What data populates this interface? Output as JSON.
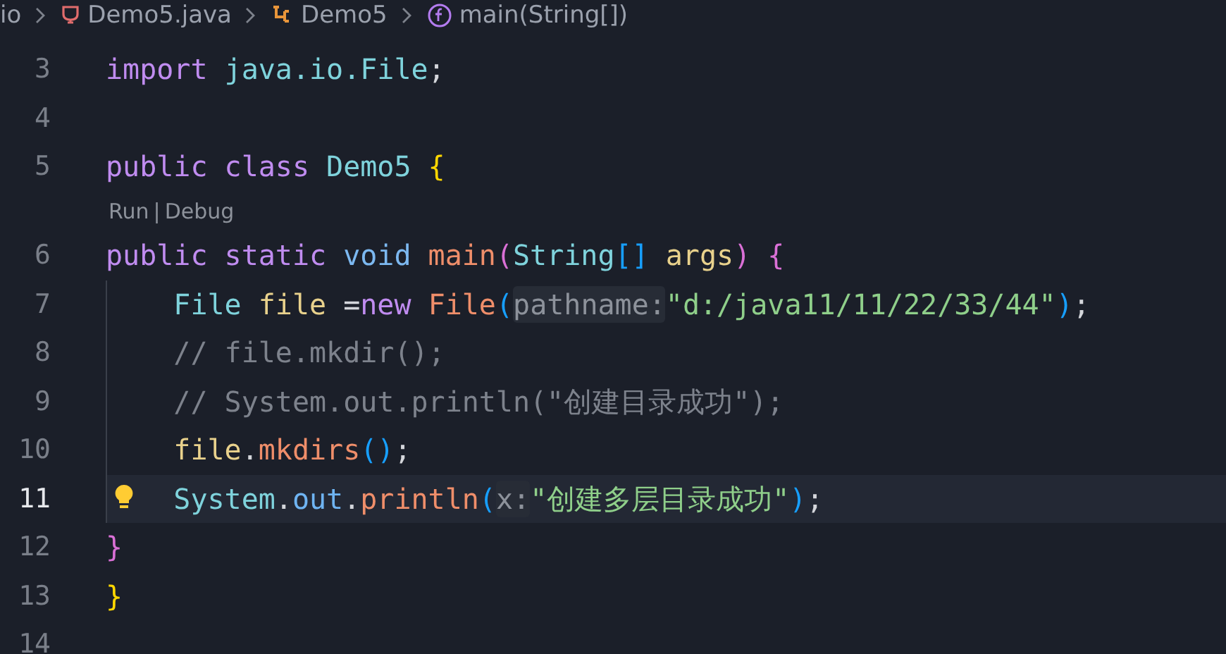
{
  "breadcrumbs": [
    {
      "kind": "folder",
      "label": "io"
    },
    {
      "kind": "file",
      "label": "Demo5.java"
    },
    {
      "kind": "class",
      "label": "Demo5"
    },
    {
      "kind": "method",
      "label": "main(String[])"
    }
  ],
  "lines": [
    {
      "kind": "code",
      "number": "3",
      "current": false,
      "lightbulb": false,
      "indented": false,
      "tokens": [
        {
          "kind": "keyword",
          "text": "import "
        },
        {
          "kind": "type",
          "text": "java.io.File"
        },
        {
          "kind": "plain",
          "text": ";"
        }
      ]
    },
    {
      "kind": "code",
      "number": "4",
      "current": false,
      "lightbulb": false,
      "indented": false
    },
    {
      "kind": "code",
      "number": "5",
      "current": false,
      "lightbulb": false,
      "indented": false,
      "tokens": [
        {
          "kind": "keyword",
          "text": "public class "
        },
        {
          "kind": "type",
          "text": "Demo5 "
        },
        {
          "kind": "bracket1",
          "text": "{"
        }
      ]
    },
    {
      "kind": "codelens",
      "items": [
        "Run",
        "Debug"
      ],
      "separator": "|"
    },
    {
      "kind": "code",
      "number": "6",
      "current": false,
      "lightbulb": false,
      "indented": false,
      "tokens": [
        {
          "kind": "keyword",
          "text": "public static "
        },
        {
          "kind": "primitive",
          "text": "void "
        },
        {
          "kind": "func",
          "text": "main"
        },
        {
          "kind": "bracket2",
          "text": "("
        },
        {
          "kind": "type",
          "text": "String"
        },
        {
          "kind": "bracket3",
          "text": "[] "
        },
        {
          "kind": "var",
          "text": "args"
        },
        {
          "kind": "bracket2",
          "text": ") "
        },
        {
          "kind": "bracket2",
          "text": "{"
        }
      ]
    },
    {
      "kind": "code",
      "number": "7",
      "current": false,
      "lightbulb": false,
      "indented": true,
      "tokens": [
        {
          "kind": "type",
          "text": "File "
        },
        {
          "kind": "var",
          "text": "file"
        },
        {
          "kind": "plain",
          "text": " ="
        },
        {
          "kind": "keyword",
          "text": "new "
        },
        {
          "kind": "func",
          "text": "File"
        },
        {
          "kind": "bracket3",
          "text": "("
        },
        {
          "kind": "hint",
          "text": "pathname:"
        },
        {
          "kind": "string",
          "text": "\"d:/java11/11/22/33/44\""
        },
        {
          "kind": "bracket3",
          "text": ")"
        },
        {
          "kind": "plain",
          "text": ";"
        }
      ]
    },
    {
      "kind": "code",
      "number": "8",
      "current": false,
      "lightbulb": false,
      "indented": true,
      "tokens": [
        {
          "kind": "comment",
          "text": "// file.mkdir();"
        }
      ]
    },
    {
      "kind": "code",
      "number": "9",
      "current": false,
      "lightbulb": false,
      "indented": true,
      "tokens": [
        {
          "kind": "comment",
          "text": "// System.out.println(\"创建目录成功\");"
        }
      ]
    },
    {
      "kind": "code",
      "number": "10",
      "current": false,
      "lightbulb": false,
      "indented": true,
      "tokens": [
        {
          "kind": "var",
          "text": "file"
        },
        {
          "kind": "plain",
          "text": "."
        },
        {
          "kind": "func",
          "text": "mkdirs"
        },
        {
          "kind": "bracket3",
          "text": "()"
        },
        {
          "kind": "plain",
          "text": ";"
        }
      ]
    },
    {
      "kind": "code",
      "number": "11",
      "current": true,
      "lightbulb": true,
      "indented": true,
      "tokens": [
        {
          "kind": "type",
          "text": "System"
        },
        {
          "kind": "plain",
          "text": "."
        },
        {
          "kind": "field",
          "text": "out"
        },
        {
          "kind": "plain",
          "text": "."
        },
        {
          "kind": "func",
          "text": "println"
        },
        {
          "kind": "bracket3",
          "text": "("
        },
        {
          "kind": "hint",
          "text": "x:"
        },
        {
          "kind": "string",
          "text": "\"创建多层目录成功\""
        },
        {
          "kind": "bracket3",
          "text": ")"
        },
        {
          "kind": "plain",
          "text": ";"
        }
      ]
    },
    {
      "kind": "code",
      "number": "12",
      "current": false,
      "lightbulb": false,
      "indented": false,
      "tokens": [
        {
          "kind": "bracket2",
          "text": "}"
        }
      ]
    },
    {
      "kind": "code",
      "number": "13",
      "current": false,
      "lightbulb": false,
      "indented": false,
      "tokens": [
        {
          "kind": "bracket1",
          "text": "}"
        }
      ]
    },
    {
      "kind": "code",
      "number": "14",
      "current": false,
      "lightbulb": false,
      "indented": false
    }
  ]
}
